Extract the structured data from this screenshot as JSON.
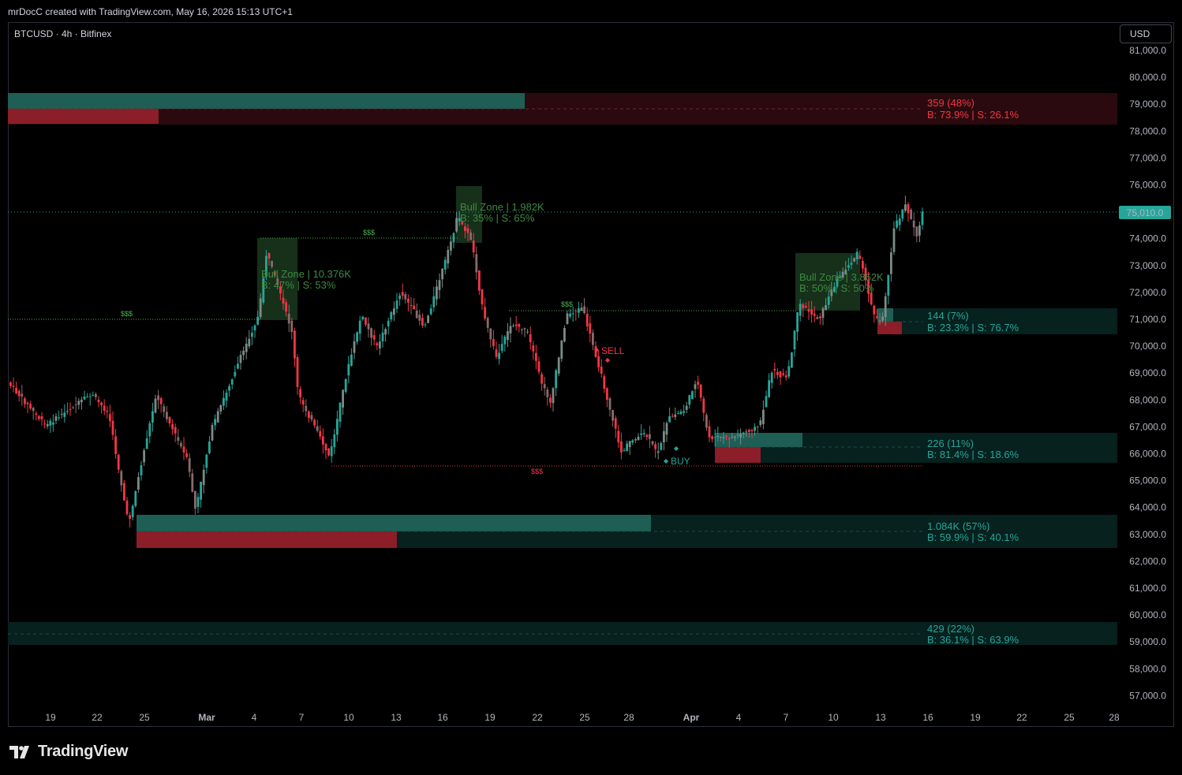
{
  "header": {
    "attribution": "mrDocC created with TradingView.com, May 16, 2026 15:13 UTC+1"
  },
  "symbol": {
    "title": "BTCUSD · 4h · Bitfinex"
  },
  "currency_button": "USD",
  "price_axis": {
    "labels": [
      "81,000.0",
      "80,000.0",
      "79,000.0",
      "78,000.0",
      "77,000.0",
      "76,000.0",
      "75,000.0",
      "74,000.0",
      "73,000.0",
      "72,000.0",
      "71,000.0",
      "70,000.0",
      "69,000.0",
      "68,000.0",
      "67,000.0",
      "66,000.0",
      "65,000.0",
      "64,000.0",
      "63,000.0",
      "62,000.0",
      "61,000.0",
      "60,000.0",
      "59,000.0",
      "58,000.0",
      "57,000.0"
    ],
    "current_price": "75,010.0"
  },
  "time_axis": {
    "labels": [
      "19",
      "22",
      "25",
      "Mar",
      "4",
      "7",
      "10",
      "13",
      "16",
      "19",
      "22",
      "25",
      "28",
      "Apr",
      "4",
      "7",
      "10",
      "13",
      "16",
      "19",
      "22",
      "25",
      "28"
    ]
  },
  "volume_profile": [
    {
      "total": "359 (48%)",
      "split": "B: 73.9% | S: 26.1%"
    },
    {
      "total": "144 (7%)",
      "split": "B: 23.3% | S: 76.7%"
    },
    {
      "total": "226 (11%)",
      "split": "B: 81.4% | S: 18.6%"
    },
    {
      "total": "1.084K (57%)",
      "split": "B: 59.9% | S: 40.1%"
    },
    {
      "total": "429 (22%)",
      "split": "B: 36.1% | S: 63.9%"
    }
  ],
  "bull_zones": [
    {
      "line1": "Bull Zone | 10.376K",
      "line2": "B: 47% | S: 53%"
    },
    {
      "line1": "Bull Zone | 1.982K",
      "line2": "B: 35% | S: 65%"
    },
    {
      "line1": "Bull Zone | 3.862K",
      "line2": "B: 50% | S: 50%"
    }
  ],
  "liquidity_marker": "$$$",
  "signals": {
    "sell": "SELL",
    "buy": "BUY"
  },
  "colors": {
    "bull": "#26a69a",
    "bear": "#f23645",
    "background": "#000000"
  },
  "footer": {
    "brand": "TradingView"
  }
}
